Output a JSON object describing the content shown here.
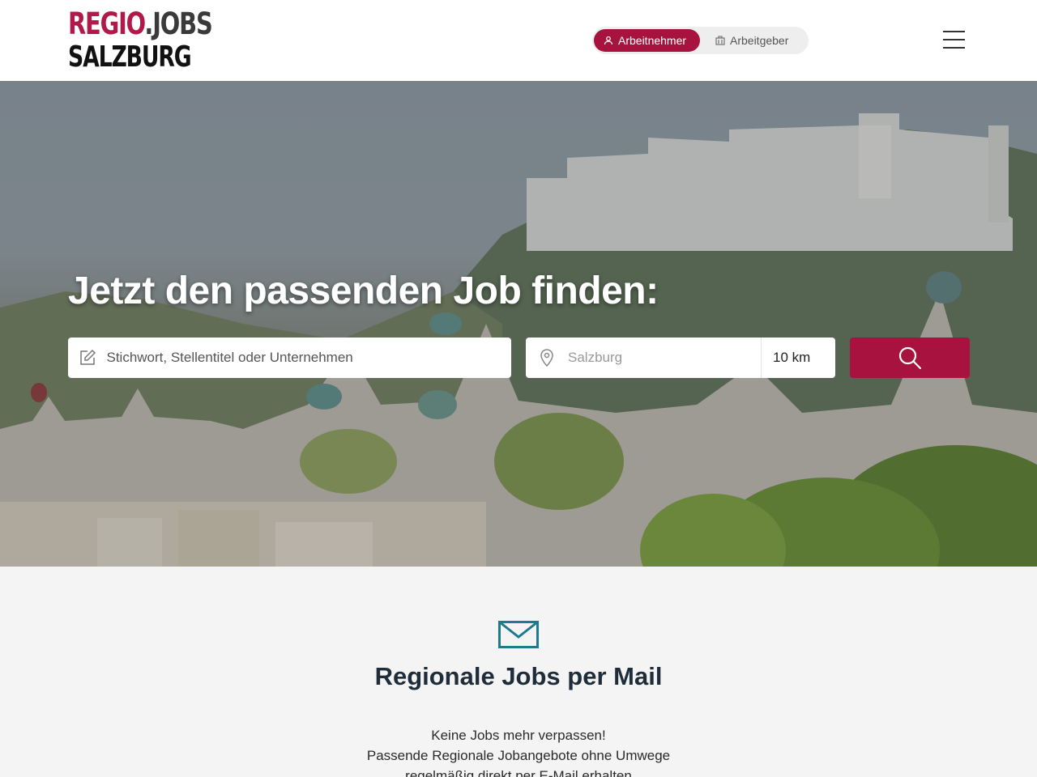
{
  "header": {
    "logo": {
      "regio": "REGIO",
      "dot": ".",
      "jobs": "JOBS",
      "region": "SALZBURG"
    },
    "role_toggle": {
      "employee_label": "Arbeitnehmer",
      "employer_label": "Arbeitgeber",
      "active": "employee"
    },
    "menu_icon": "hamburger-icon"
  },
  "hero": {
    "title": "Jetzt den passenden Job finden:",
    "keyword_placeholder": "Stichwort, Stellentitel oder Unternehmen",
    "location_placeholder": "Salzburg",
    "radius_value": "10 km",
    "search_icon": "search-icon"
  },
  "mail": {
    "icon": "envelope-icon",
    "title": "Regionale Jobs per Mail",
    "line1": "Keine Jobs mehr verpassen!",
    "line2": "Passende Regionale Jobangebote ohne Umwege",
    "line3": "regelmäßig direkt per E-Mail erhalten"
  },
  "colors": {
    "brand": "#a8123e",
    "logo_red": "#b0194a",
    "accent_teal": "#1e7a8f",
    "text_dark": "#1f2d3a"
  }
}
